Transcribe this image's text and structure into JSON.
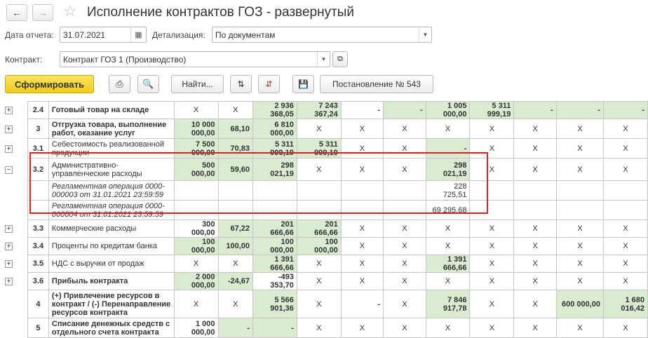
{
  "header": {
    "title": "Исполнение контрактов ГОЗ - развернутый"
  },
  "form": {
    "date_label": "Дата отчета:",
    "date_value": "31.07.2021",
    "detail_label": "Детализация:",
    "detail_value": "По документам",
    "contract_label": "Контракт:",
    "contract_value": "Контракт ГОЗ 1 (Производство)"
  },
  "toolbar": {
    "generate": "Сформировать",
    "find": "Найти...",
    "decree": "Постановление № 543"
  },
  "table": {
    "rows": [
      {
        "exp": "+",
        "n": "2.4",
        "name": "Готовый товар на складе",
        "c": [
          "X",
          "X",
          "2 936 368,05",
          "7 243 367,24",
          "-",
          "-",
          "1 005 000,00",
          "5 311 999,19",
          "-",
          "-",
          "-"
        ]
      },
      {
        "exp": "+",
        "n": "3",
        "name": "Отгрузка товара, выполнение работ, оказание услуг",
        "c": [
          "10 000 000,00",
          "68,10",
          "6 810 000,00",
          "X",
          "X",
          "X",
          "X",
          "X",
          "X",
          "X",
          "X"
        ]
      },
      {
        "exp": "+",
        "n": "3.1",
        "name": "Себестоимость реализованной продукции",
        "c": [
          "7 500 000,00",
          "70,83",
          "5 311 999,19",
          "5 311 999,19",
          "X",
          "X",
          "-",
          "X",
          "X",
          "X",
          "X"
        ]
      },
      {
        "exp": "−",
        "n": "3.2",
        "name": "Административно-управленческие расходы",
        "c": [
          "500 000,00",
          "59,60",
          "298 021,19",
          "X",
          "X",
          "X",
          "298 021,19",
          "X",
          "X",
          "X",
          "X"
        ]
      },
      {
        "exp": "",
        "n": "",
        "name": "Регламентная операция 0000-000003 от 31.01.2021 23:59:59",
        "c": [
          "",
          "",
          "",
          "",
          "",
          "",
          "228 725,51",
          "",
          "",
          "",
          ""
        ]
      },
      {
        "exp": "",
        "n": "",
        "name": "Регламентная операция 0000-000004 от 31.01.2021 23:59:59",
        "c": [
          "",
          "",
          "",
          "",
          "",
          "",
          "69 295,68",
          "",
          "",
          "",
          ""
        ]
      },
      {
        "exp": "+",
        "n": "3.3",
        "name": "Коммерческие расходы",
        "c": [
          "300 000,00",
          "67,22",
          "201 666,66",
          "201 666,66",
          "X",
          "X",
          "X",
          "X",
          "X",
          "X",
          "X"
        ]
      },
      {
        "exp": "+",
        "n": "3.4",
        "name": "Проценты по кредитам банка",
        "c": [
          "100 000,00",
          "100,00",
          "100 000,00",
          "100 000,00",
          "X",
          "X",
          "X",
          "X",
          "X",
          "X",
          "X"
        ]
      },
      {
        "exp": "+",
        "n": "3.5",
        "name": "НДС с выручки от продаж",
        "c": [
          "X",
          "X",
          "1 391 666,66",
          "X",
          "X",
          "X",
          "1 391 666,66",
          "X",
          "X",
          "X",
          "X"
        ]
      },
      {
        "exp": "+",
        "n": "3.6",
        "name": "Прибыль контракта",
        "c": [
          "2 000 000,00",
          "-24,67",
          "-493 353,70",
          "X",
          "X",
          "X",
          "X",
          "X",
          "X",
          "X",
          "X"
        ]
      },
      {
        "exp": "",
        "n": "4",
        "name": "(+) Привлечение ресурсов в контракт / (-) Перенаправление ресурсов контракта",
        "c": [
          "X",
          "X",
          "5 566 901,36",
          "X",
          "-",
          "X",
          "7 846 917,78",
          "X",
          "X",
          "600 000,00",
          "1 680 016,42"
        ]
      },
      {
        "exp": "",
        "n": "5",
        "name": "Списание денежных средств с отдельного счета контракта",
        "c": [
          "1 000 000,00",
          "-",
          "-",
          "X",
          "X",
          "X",
          "X",
          "X",
          "X",
          "X",
          "X"
        ]
      }
    ]
  }
}
